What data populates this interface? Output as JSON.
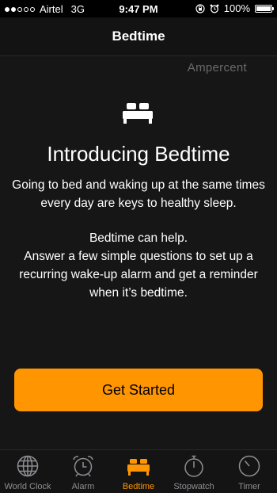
{
  "status_bar": {
    "carrier": "Airtel",
    "network": "3G",
    "time": "9:47 PM",
    "battery": "100%",
    "signal_bars_filled": 2,
    "signal_bars_total": 5
  },
  "nav": {
    "title": "Bedtime"
  },
  "watermark": "Ampercent",
  "intro": {
    "icon": "bed-icon",
    "title": "Introducing Bedtime",
    "paragraph1": "Going to bed and waking up at the same times every day are keys to healthy sleep.",
    "paragraph2": "Bedtime can help.",
    "paragraph3": "Answer a few simple questions to set up a recurring wake-up alarm and get a reminder when it’s bedtime."
  },
  "cta": {
    "label": "Get Started"
  },
  "tabs": [
    {
      "label": "World Clock",
      "icon": "globe-icon",
      "active": false
    },
    {
      "label": "Alarm",
      "icon": "alarm-clock-icon",
      "active": false
    },
    {
      "label": "Bedtime",
      "icon": "bed-icon",
      "active": true
    },
    {
      "label": "Stopwatch",
      "icon": "stopwatch-icon",
      "active": false
    },
    {
      "label": "Timer",
      "icon": "timer-icon",
      "active": false
    }
  ],
  "colors": {
    "accent": "#ff9500",
    "background": "#161616",
    "inactive": "#8e8e93"
  }
}
